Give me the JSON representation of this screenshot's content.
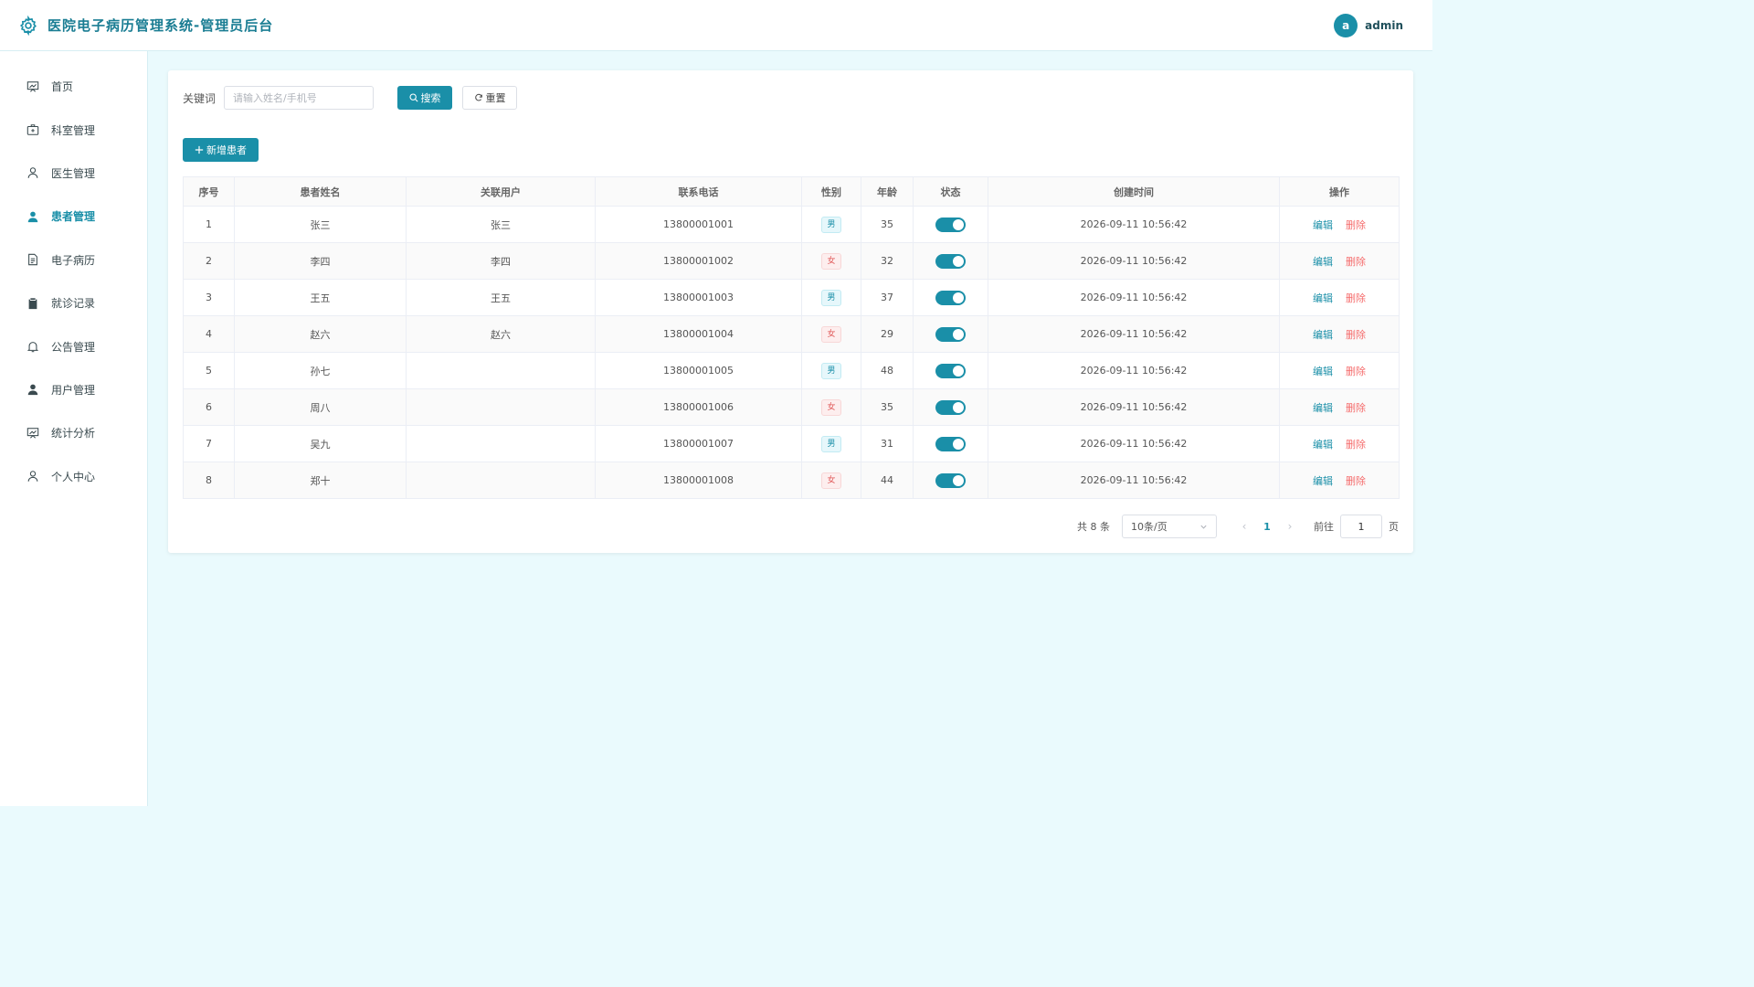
{
  "header": {
    "title": "医院电子病历管理系统-管理员后台",
    "avatar_letter": "a",
    "username": "admin"
  },
  "sidebar": {
    "items": [
      {
        "label": "首页",
        "icon": "dashboard-icon",
        "active": false
      },
      {
        "label": "科室管理",
        "icon": "first-aid-kit-icon",
        "active": false
      },
      {
        "label": "医生管理",
        "icon": "user-outline-icon",
        "active": false
      },
      {
        "label": "患者管理",
        "icon": "user-filled-icon",
        "active": true
      },
      {
        "label": "电子病历",
        "icon": "document-icon",
        "active": false
      },
      {
        "label": "就诊记录",
        "icon": "clipboard-icon",
        "active": false
      },
      {
        "label": "公告管理",
        "icon": "bell-icon",
        "active": false
      },
      {
        "label": "用户管理",
        "icon": "user-filled-icon",
        "active": false
      },
      {
        "label": "统计分析",
        "icon": "chart-icon",
        "active": false
      },
      {
        "label": "个人中心",
        "icon": "user-outline-icon",
        "active": false
      }
    ]
  },
  "search": {
    "label": "关键词",
    "placeholder": "请输入姓名/手机号",
    "value": "",
    "search_button": "搜索",
    "reset_button": "重置"
  },
  "add_button": "新增患者",
  "table": {
    "columns": [
      "序号",
      "患者姓名",
      "关联用户",
      "联系电话",
      "性别",
      "年龄",
      "状态",
      "创建时间",
      "操作"
    ],
    "rows": [
      {
        "index": "1",
        "name": "张三",
        "user": "张三",
        "phone": "13800001001",
        "gender": "男",
        "age": "35",
        "enabled": true,
        "created": "2026-09-11 10:56:42"
      },
      {
        "index": "2",
        "name": "李四",
        "user": "李四",
        "phone": "13800001002",
        "gender": "女",
        "age": "32",
        "enabled": true,
        "created": "2026-09-11 10:56:42"
      },
      {
        "index": "3",
        "name": "王五",
        "user": "王五",
        "phone": "13800001003",
        "gender": "男",
        "age": "37",
        "enabled": true,
        "created": "2026-09-11 10:56:42"
      },
      {
        "index": "4",
        "name": "赵六",
        "user": "赵六",
        "phone": "13800001004",
        "gender": "女",
        "age": "29",
        "enabled": true,
        "created": "2026-09-11 10:56:42"
      },
      {
        "index": "5",
        "name": "孙七",
        "user": "",
        "phone": "13800001005",
        "gender": "男",
        "age": "48",
        "enabled": true,
        "created": "2026-09-11 10:56:42"
      },
      {
        "index": "6",
        "name": "周八",
        "user": "",
        "phone": "13800001006",
        "gender": "女",
        "age": "35",
        "enabled": true,
        "created": "2026-09-11 10:56:42"
      },
      {
        "index": "7",
        "name": "吴九",
        "user": "",
        "phone": "13800001007",
        "gender": "男",
        "age": "31",
        "enabled": true,
        "created": "2026-09-11 10:56:42"
      },
      {
        "index": "8",
        "name": "郑十",
        "user": "",
        "phone": "13800001008",
        "gender": "女",
        "age": "44",
        "enabled": true,
        "created": "2026-09-11 10:56:42"
      }
    ],
    "actions": {
      "edit": "编辑",
      "delete": "删除"
    }
  },
  "pagination": {
    "total_text": "共 8 条",
    "page_size": "10条/页",
    "current_page": "1",
    "jump_label": "前往",
    "jump_value": "1",
    "page_suffix": "页"
  },
  "colors": {
    "accent": "#1a8fa8",
    "danger": "#f56c6c",
    "background": "#eafafd"
  }
}
